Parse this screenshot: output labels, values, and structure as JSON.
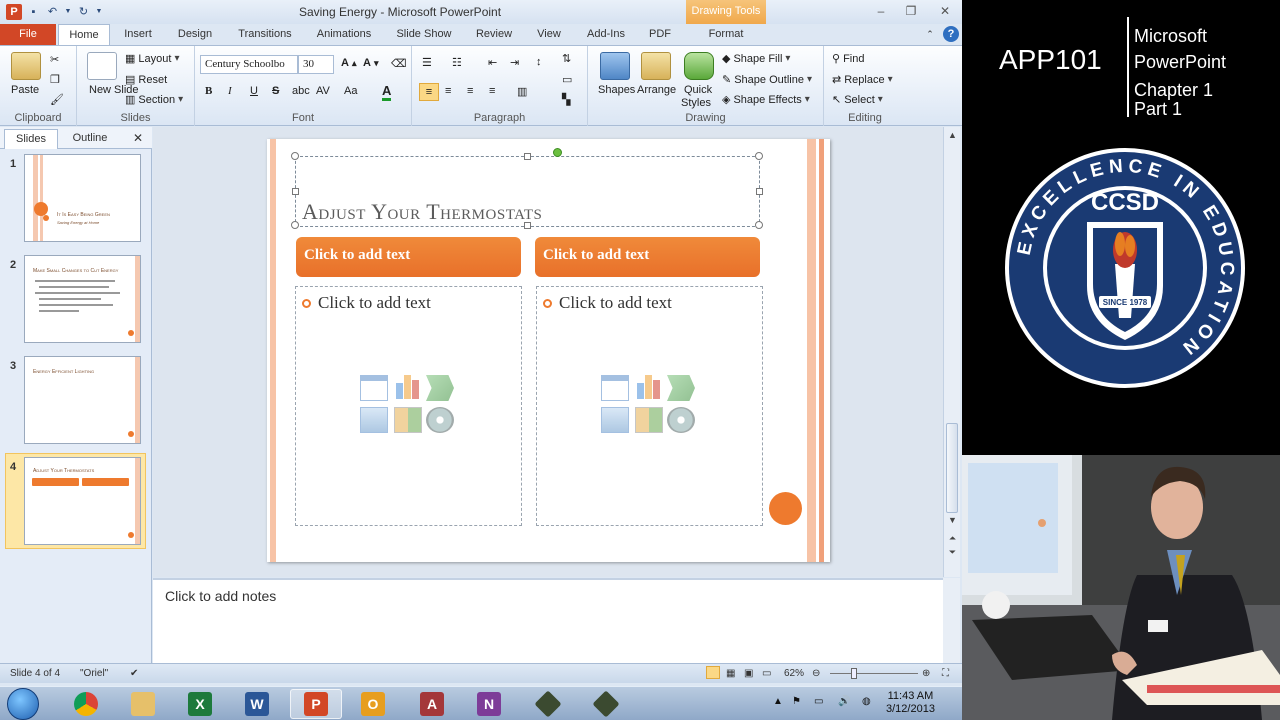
{
  "window": {
    "title": "Saving Energy - Microsoft PowerPoint",
    "contextual_tab": "Drawing Tools"
  },
  "tabs": [
    "File",
    "Home",
    "Insert",
    "Design",
    "Transitions",
    "Animations",
    "Slide Show",
    "Review",
    "View",
    "Add-Ins",
    "PDF",
    "Format"
  ],
  "ribbon": {
    "clipboard": {
      "label": "Clipboard",
      "paste": "Paste"
    },
    "slides": {
      "label": "Slides",
      "new_slide": "New Slide",
      "layout": "Layout",
      "reset": "Reset",
      "section": "Section"
    },
    "font": {
      "label": "Font",
      "font_name": "Century Schoolbo",
      "font_size": "30",
      "bold": "B",
      "italic": "I",
      "underline": "U",
      "strike": "S",
      "case": "Aa"
    },
    "paragraph": {
      "label": "Paragraph"
    },
    "drawing": {
      "label": "Drawing",
      "shapes": "Shapes",
      "arrange": "Arrange",
      "quick_styles_1": "Quick",
      "quick_styles_2": "Styles",
      "shape_fill": "Shape Fill",
      "shape_outline": "Shape Outline",
      "shape_effects": "Shape Effects"
    },
    "editing": {
      "label": "Editing",
      "find": "Find",
      "replace": "Replace",
      "select": "Select"
    }
  },
  "pane": {
    "tab_slides": "Slides",
    "tab_outline": "Outline",
    "thumbnails": [
      {
        "num": "1",
        "title": "It Is Easy Being Green",
        "subtitle": "Saving Energy at Home"
      },
      {
        "num": "2",
        "title": "Make Small Changes to Cut Energy"
      },
      {
        "num": "3",
        "title": "Energy Efficient Lighting"
      },
      {
        "num": "4",
        "title": "Adjust Your Thermostats"
      }
    ]
  },
  "slide": {
    "title": "Adjust Your Thermostats",
    "left_header": "Click to add text",
    "right_header": "Click to add text",
    "left_bullet": "Click to add text",
    "right_bullet": "Click to add text"
  },
  "notes": {
    "placeholder": "Click to add notes"
  },
  "statusbar": {
    "slide_info": "Slide 4 of 4",
    "theme": "\"Oriel\"",
    "zoom": "62%"
  },
  "taskbar": {
    "apps": [
      "chrome",
      "explorer",
      "excel",
      "word",
      "powerpoint",
      "outlook",
      "access",
      "onenote",
      "app-1",
      "app-2"
    ],
    "time": "11:43 AM",
    "date": "3/12/2013"
  },
  "branding": {
    "course": "APP101",
    "line1": "Microsoft",
    "line2": "PowerPoint",
    "line3": "Chapter 1",
    "line4": "Part 1",
    "seal_text": "EXCELLENCE IN EDUCATION",
    "seal_center": "CCSD",
    "seal_since": "SINCE 1978"
  },
  "colors": {
    "accent_orange": "#ee7a2e",
    "file_tab": "#d24726",
    "seal_blue": "#1a3a73"
  }
}
